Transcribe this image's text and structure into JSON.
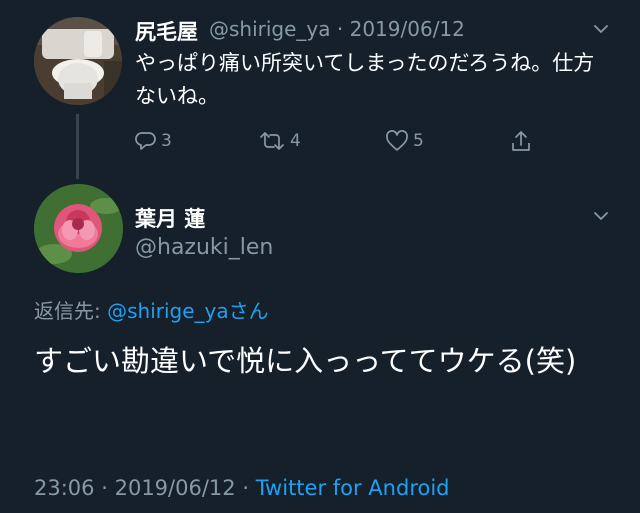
{
  "colors": {
    "background": "#15202b",
    "text_primary": "#ffffff",
    "text_secondary": "#8899a6",
    "accent": "#1da1f2",
    "thread_line": "#38444d"
  },
  "parent_tweet": {
    "display_name": "尻毛屋",
    "handle": "@shirige_ya",
    "separator": "·",
    "date": "2019/06/12",
    "text": "やっぱり痛い所突いてしまったのだろうね。仕方ないね。",
    "actions": {
      "reply_count": "3",
      "retweet_count": "4",
      "like_count": "5"
    },
    "icons": [
      "chevron-down-icon",
      "reply-icon",
      "retweet-icon",
      "like-icon",
      "share-icon"
    ]
  },
  "reply_tweet": {
    "display_name": "葉月 蓮",
    "handle": "@hazuki_len",
    "replying_to": {
      "prefix": "返信先: ",
      "mention": "@shirige_ya",
      "suffix": "さん"
    },
    "text": "すごい勘違いで悦に入っっててウケる(笑)",
    "time": "23:06",
    "separator": "·",
    "date": "2019/06/12",
    "separator2": "·",
    "source": "Twitter for Android"
  }
}
